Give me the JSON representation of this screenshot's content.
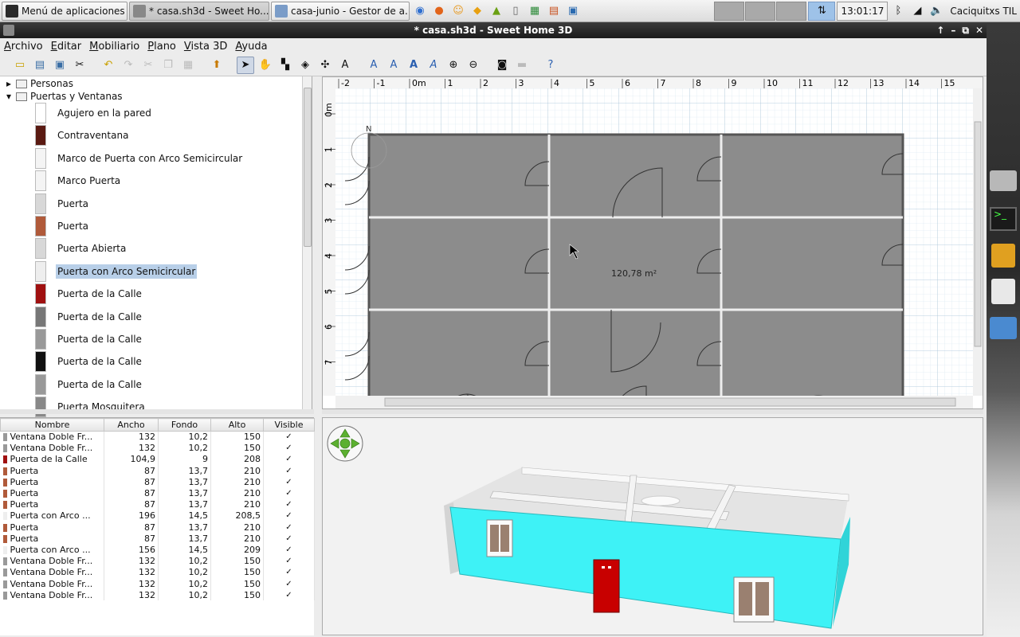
{
  "taskbar": {
    "start_label": "Menú de aplicaciones",
    "tasks": [
      {
        "label": "* casa.sh3d - Sweet Ho...",
        "active": true
      },
      {
        "label": "casa-junio - Gestor de a...",
        "active": false
      }
    ],
    "clock": "13:01:17",
    "user": "Caciquitxs TIL"
  },
  "window": {
    "title": "* casa.sh3d - Sweet Home 3D",
    "controls": [
      "↑",
      "–",
      "⧉",
      "✕"
    ]
  },
  "menu": [
    "Archivo",
    "Editar",
    "Mobiliario",
    "Plano",
    "Vista 3D",
    "Ayuda"
  ],
  "catalog": {
    "categories": [
      {
        "label": "Personas",
        "expanded": false
      },
      {
        "label": "Puertas y Ventanas",
        "expanded": true
      }
    ],
    "items": [
      {
        "label": "Agujero en la pared",
        "color": "#ffffff",
        "selected": false
      },
      {
        "label": "Contraventana",
        "color": "#5a1a12",
        "selected": false
      },
      {
        "label": "Marco de Puerta con Arco Semicircular",
        "color": "#f4f4f4",
        "selected": false
      },
      {
        "label": "Marco Puerta",
        "color": "#f4f4f4",
        "selected": false
      },
      {
        "label": "Puerta",
        "color": "#d8d8d8",
        "selected": false
      },
      {
        "label": "Puerta",
        "color": "#b05a3a",
        "selected": false
      },
      {
        "label": "Puerta Abierta",
        "color": "#d8d8d8",
        "selected": false
      },
      {
        "label": "Puerta con Arco Semicircular",
        "color": "#eeeeee",
        "selected": true
      },
      {
        "label": "Puerta de la Calle",
        "color": "#a01010",
        "selected": false
      },
      {
        "label": "Puerta de la Calle",
        "color": "#777777",
        "selected": false
      },
      {
        "label": "Puerta de la Calle",
        "color": "#999999",
        "selected": false
      },
      {
        "label": "Puerta de la Calle",
        "color": "#111111",
        "selected": false
      },
      {
        "label": "Puerta de la Calle",
        "color": "#999999",
        "selected": false
      },
      {
        "label": "Puerta Mosquitera",
        "color": "#888888",
        "selected": false
      }
    ]
  },
  "furniture": {
    "headers": [
      "Nombre",
      "Ancho",
      "Fondo",
      "Alto",
      "Visible"
    ],
    "rows": [
      {
        "name": "Ventana Doble Fr...",
        "w": "132",
        "d": "10,2",
        "h": "150",
        "color": "#999999"
      },
      {
        "name": "Ventana Doble Fr...",
        "w": "132",
        "d": "10,2",
        "h": "150",
        "color": "#999999"
      },
      {
        "name": "Puerta de la Calle",
        "w": "104,9",
        "d": "9",
        "h": "208",
        "color": "#a01010"
      },
      {
        "name": "Puerta",
        "w": "87",
        "d": "13,7",
        "h": "210",
        "color": "#b05a3a"
      },
      {
        "name": "Puerta",
        "w": "87",
        "d": "13,7",
        "h": "210",
        "color": "#b05a3a"
      },
      {
        "name": "Puerta",
        "w": "87",
        "d": "13,7",
        "h": "210",
        "color": "#b05a3a"
      },
      {
        "name": "Puerta",
        "w": "87",
        "d": "13,7",
        "h": "210",
        "color": "#b05a3a"
      },
      {
        "name": "Puerta con Arco ...",
        "w": "196",
        "d": "14,5",
        "h": "208,5",
        "color": "#eeeeee"
      },
      {
        "name": "Puerta",
        "w": "87",
        "d": "13,7",
        "h": "210",
        "color": "#b05a3a"
      },
      {
        "name": "Puerta",
        "w": "87",
        "d": "13,7",
        "h": "210",
        "color": "#b05a3a"
      },
      {
        "name": "Puerta con Arco ...",
        "w": "156",
        "d": "14,5",
        "h": "209",
        "color": "#eeeeee"
      },
      {
        "name": "Ventana Doble Fr...",
        "w": "132",
        "d": "10,2",
        "h": "150",
        "color": "#999999"
      },
      {
        "name": "Ventana Doble Fr...",
        "w": "132",
        "d": "10,2",
        "h": "150",
        "color": "#999999"
      },
      {
        "name": "Ventana Doble Fr...",
        "w": "132",
        "d": "10,2",
        "h": "150",
        "color": "#999999"
      },
      {
        "name": "Ventana Doble Fr...",
        "w": "132",
        "d": "10,2",
        "h": "150",
        "color": "#999999"
      }
    ],
    "visible_mark": "✓"
  },
  "plan": {
    "ruler_x": [
      "-2",
      "-1",
      "0m",
      "1",
      "2",
      "3",
      "4",
      "5",
      "6",
      "7",
      "8",
      "9",
      "10",
      "11",
      "12",
      "13",
      "14",
      "15"
    ],
    "ruler_y": [
      "0m",
      "1",
      "2",
      "3",
      "4",
      "5",
      "6",
      "7"
    ],
    "area_label": "120,78 m²",
    "north_label": "N"
  },
  "colors": {
    "room_fill": "#8c8c8c",
    "wall_3d": "#3ef2f6",
    "selection": "#b8cfe8",
    "door_red": "#c80000"
  }
}
